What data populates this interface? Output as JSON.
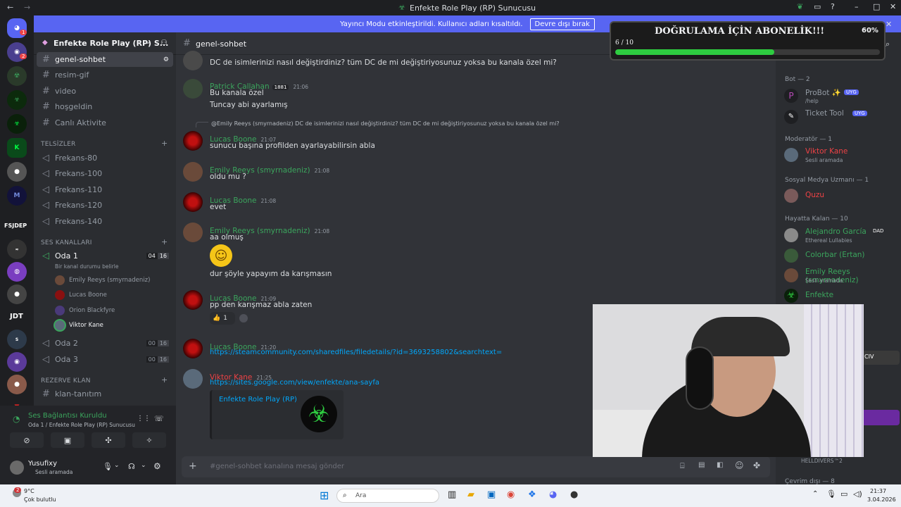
{
  "window": {
    "title": "Enfekte Role Play (RP) Sunucusu"
  },
  "banner": {
    "text": "Yayıncı Modu etkinleştirildi. Kullanıcı adları kısaltıldı.",
    "button": "Devre dışı bırak"
  },
  "server_rail": {
    "items": [
      "FSJDEP",
      "JDT"
    ],
    "badges": {
      "home": "1",
      "second": "2"
    }
  },
  "server": {
    "name": "Enfekte Role Play (RP) S..."
  },
  "channels": {
    "text": [
      {
        "name": "genel-sohbet",
        "active": true
      },
      {
        "name": "resim-gif"
      },
      {
        "name": "video"
      },
      {
        "name": "hoşgeldin"
      },
      {
        "name": "Canlı Aktivite"
      }
    ],
    "telsizler_label": "TELSİZLER",
    "telsizler": [
      "Frekans-80",
      "Frekans-100",
      "Frekans-110",
      "Frekans-120",
      "Frekans-140"
    ],
    "ses_label": "SES KANALLARI",
    "oda1": {
      "name": "Oda 1",
      "status": "Bir kanal durumu belirle",
      "c1": "04",
      "c2": "16",
      "members": [
        "Emily Reeys (smyrnadeniz)",
        "Lucas Boone",
        "Orion Blackfyre",
        "Viktor Kane"
      ]
    },
    "oda2": {
      "name": "Oda 2",
      "c1": "00",
      "c2": "16"
    },
    "oda3": {
      "name": "Oda 3",
      "c1": "00",
      "c2": "16"
    },
    "rezerve_label": "REZERVE KLAN",
    "rezerve": [
      "klan-tanıtım"
    ]
  },
  "voice": {
    "status": "Ses Bağlantısı Kuruldu",
    "location": "Oda 1 / Enfekte Role Play (RP) Sunucusu"
  },
  "user": {
    "name": "Yusufixy",
    "status": "Sesli aramada"
  },
  "chat": {
    "channel": "genel-sohbet",
    "input_placeholder": "#genel-sohbet kanalına mesaj gönder",
    "top_text": "DC de isimlerinizi nasıl değiştirdiniz? tüm DC de mi değiştiriyosunuz yoksa bu kanala özel mi?",
    "messages": [
      {
        "author": "Patrick Callahan",
        "badge": "1881",
        "time": "21:06",
        "lines": [
          "Bu kanala özel",
          "Tuncay abi ayarlamış"
        ]
      },
      {
        "reply": "@Emily Reeys (smyrnadeniz) DC de isimlerinizi nasıl değiştirdiniz? tüm DC de mi değiştiriyosunuz yoksa bu kanala özel mi?",
        "author": "Lucas Boone",
        "time": "21:07",
        "lines": [
          "sunucu başına profilden ayarlayabilirsin abla"
        ]
      },
      {
        "author": "Emily Reeys (smyrnadeniz)",
        "time": "21:08",
        "lines": [
          "oldu mu ?"
        ]
      },
      {
        "author": "Lucas Boone",
        "time": "21:08",
        "lines": [
          "evet"
        ]
      },
      {
        "author": "Emily Reeys (smyrnadeniz)",
        "time": "21:08",
        "lines": [
          "aa olmuş",
          "dur şöyle yapayım da karışmasın"
        ]
      },
      {
        "author": "Lucas Boone",
        "time": "21:09",
        "lines": [
          "pp den karışmaz abla zaten"
        ],
        "reaction": "1"
      },
      {
        "author": "Lucas Boone",
        "time": "21:20",
        "link": "https://steamcommunity.com/sharedfiles/filedetails/?id=3693258802&searchtext="
      },
      {
        "author": "Viktor Kane",
        "time": "21:25",
        "link": "https://sites.google.com/view/enfekte/ana-sayfa",
        "embed": "Enfekte Role Play (RP)"
      }
    ]
  },
  "overlay": {
    "title": "DOĞRULAMA İÇİN ABONELİK!!!",
    "percent": "60%",
    "count": "6 / 10",
    "progress": 0.6
  },
  "members": {
    "groups": [
      {
        "label": "Bot — 2",
        "items": [
          {
            "name": "ProBot ✨",
            "sub": "/help",
            "tag": "UYG"
          },
          {
            "name": "Ticket Tool",
            "sub": "",
            "tag": "UYG"
          }
        ]
      },
      {
        "label": "Moderatör — 1",
        "items": [
          {
            "name": "Viktor Kane",
            "sub": "Sesli aramada"
          }
        ]
      },
      {
        "label": "Sosyal Medya Uzmanı — 1",
        "items": [
          {
            "name": "Quzu",
            "sub": ""
          }
        ]
      },
      {
        "label": "Hayatta Kalan — 10",
        "items": [
          {
            "name": "Alejandro García",
            "sub": "Ethereal Lullabies",
            "tag": "DAD"
          },
          {
            "name": "Colorbar (Ertan)",
            "sub": ""
          },
          {
            "name": "Emily Reeys (smyrnadeniz)",
            "sub": "Sesli aramada"
          },
          {
            "name": "Enfekte",
            "sub": ""
          }
        ]
      }
    ],
    "footer_activity": "HELLDIVERS™2",
    "offline": "Çevrim dışı — 8",
    "partial_tag": "CIV"
  },
  "taskbar": {
    "temp": "9°C",
    "weather": "Çok bulutlu",
    "search": "Ara",
    "time": "21:37",
    "date": "3.04.2026",
    "weather_badge": "2"
  },
  "colors": {
    "accent": "#5865f2",
    "green": "#3ba55d",
    "red": "#ed4245",
    "progress": "#2ecc40"
  }
}
